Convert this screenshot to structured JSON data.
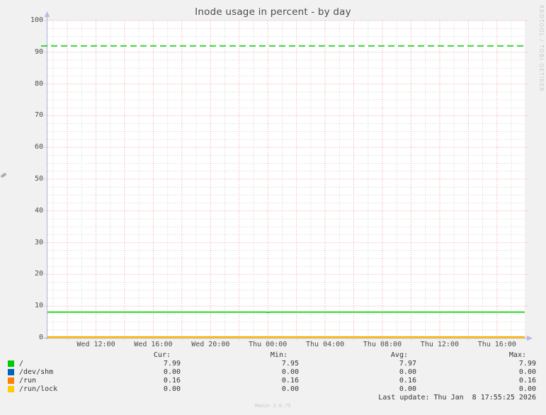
{
  "title": "Inode usage in percent - by day",
  "rrdtool_credit": "RRDTOOL / TOBI OETIKER",
  "watermark": "Munin 2.0.75",
  "last_update": "Last update: Thu Jan  8 17:55:25 2026",
  "legend": {
    "headers": {
      "cur": "Cur:",
      "min": "Min:",
      "avg": "Avg:",
      "max": "Max:"
    }
  },
  "colors": {
    "plot_background": "#ffffff",
    "page_background": "#f1f1f1",
    "major_grid": "#f2a2a2",
    "minor_grid": "#d6d6d6",
    "axis": "#b7bbdf",
    "warning_line": "#00cc00"
  },
  "chart_data": {
    "type": "line",
    "title": "Inode usage in percent - by day",
    "xlabel": "",
    "ylabel": "%",
    "ylim": [
      0,
      100
    ],
    "y_major_step": 10,
    "y_minor_step": 2.5,
    "grid": true,
    "y_tick_labels": [
      "0",
      "10",
      "20",
      "30",
      "40",
      "50",
      "60",
      "70",
      "80",
      "90",
      "100"
    ],
    "x_tick_labels": [
      "Wed 12:00",
      "Wed 16:00",
      "Wed 20:00",
      "Thu 00:00",
      "Thu 04:00",
      "Thu 08:00",
      "Thu 12:00",
      "Thu 16:00"
    ],
    "x_minor_every_hours": 1,
    "x_major_every_hours": 2,
    "x_label_every_hours": 4,
    "warning_line": {
      "value": 92,
      "color": "#00cc00",
      "style": "dashed"
    },
    "series": [
      {
        "name": "/",
        "color": "#00cc00",
        "cur": "7.99",
        "min": "7.95",
        "avg": "7.97",
        "max": "7.99",
        "points_pct": [
          [
            0,
            7.99
          ],
          [
            0.458,
            7.99
          ],
          [
            0.4595,
            7.95
          ],
          [
            0.4655,
            7.95
          ],
          [
            0.467,
            7.99
          ],
          [
            1,
            7.99
          ]
        ]
      },
      {
        "name": "/dev/shm",
        "color": "#0066b3",
        "cur": "0.00",
        "min": "0.00",
        "avg": "0.00",
        "max": "0.00",
        "points_pct": [
          [
            0,
            0
          ],
          [
            1,
            0
          ]
        ]
      },
      {
        "name": "/run",
        "color": "#ff8000",
        "cur": "0.16",
        "min": "0.16",
        "avg": "0.16",
        "max": "0.16",
        "points_pct": [
          [
            0,
            0.16
          ],
          [
            1,
            0.16
          ]
        ]
      },
      {
        "name": "/run/lock",
        "color": "#ffcc00",
        "cur": "0.00",
        "min": "0.00",
        "avg": "0.00",
        "max": "0.00",
        "points_pct": [
          [
            0,
            0
          ],
          [
            1,
            0
          ]
        ]
      }
    ]
  }
}
